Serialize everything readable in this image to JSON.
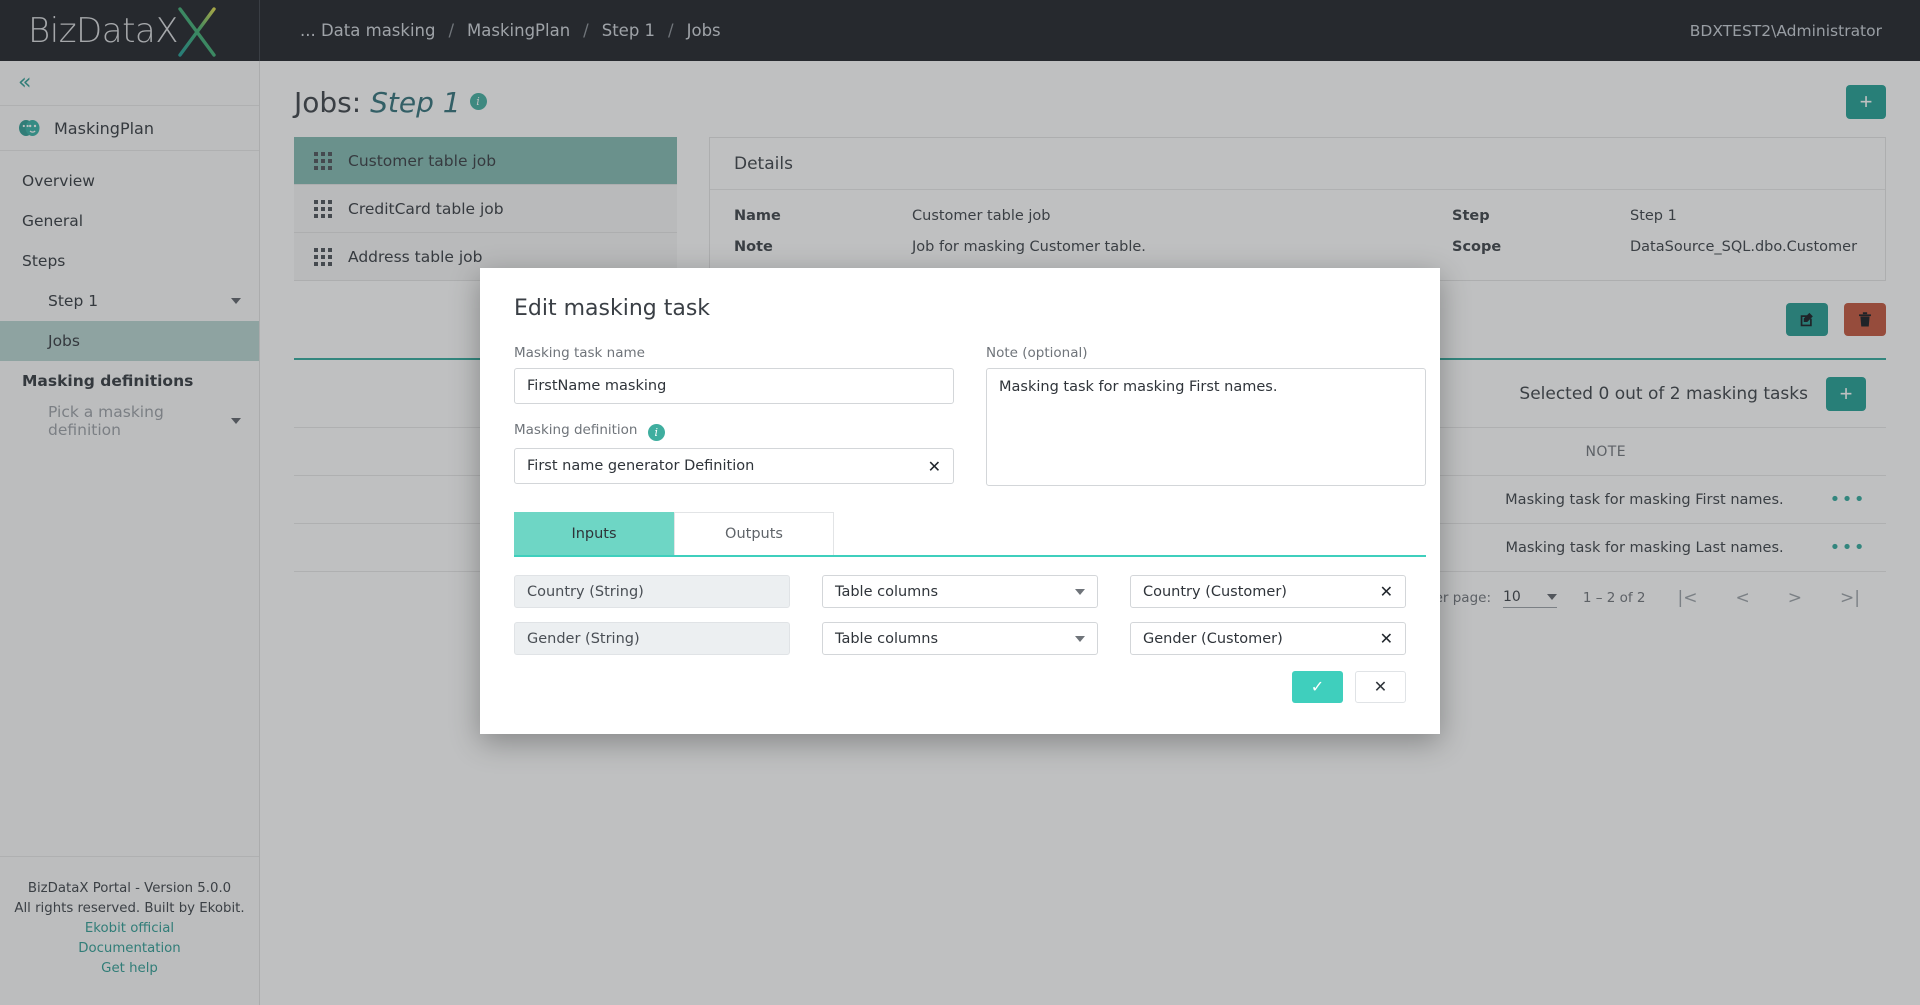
{
  "brand": {
    "name": "BizDataX",
    "logo_icon": "bizdatax-logo"
  },
  "topbar": {
    "breadcrumb": [
      {
        "label": "... Data masking"
      },
      {
        "label": "MaskingPlan"
      },
      {
        "label": "Step 1"
      },
      {
        "label": "Jobs"
      }
    ],
    "separator": "/",
    "user": "BDXTEST2\\Administrator"
  },
  "sidebar": {
    "collapse_icon": "double-chevron-left-icon",
    "plan": {
      "label": "MaskingPlan",
      "icon": "masks-icon"
    },
    "items": [
      {
        "label": "Overview"
      },
      {
        "label": "General"
      },
      {
        "label": "Steps"
      },
      {
        "label": "Step 1"
      },
      {
        "label": "Jobs"
      },
      {
        "label": "Masking definitions"
      },
      {
        "label": "Pick a masking definition"
      }
    ],
    "footer": {
      "version": "BizDataX Portal - Version 5.0.0",
      "rights": "All rights reserved. Built by Ekobit.",
      "links": [
        "Ekobit official",
        "Documentation",
        "Get help"
      ]
    }
  },
  "page": {
    "title_prefix": "Jobs: ",
    "title_em": "Step 1",
    "info_icon_glyph": "i",
    "add_button_label": "+"
  },
  "jobs": [
    {
      "label": "Customer table job"
    },
    {
      "label": "CreditCard table job"
    },
    {
      "label": "Address table job"
    }
  ],
  "details": {
    "heading": "Details",
    "rows": [
      {
        "k1": "Name",
        "v1": "Customer table job",
        "k2": "Step",
        "v2": "Step 1"
      },
      {
        "k1": "Note",
        "v1": "Job for masking Customer table.",
        "k2": "Scope",
        "v2": "DataSource_SQL.dbo.Customer"
      }
    ]
  },
  "actions": {
    "edit_icon": "edit-pencil-icon",
    "delete_icon": "trash-icon"
  },
  "tasks": {
    "selection_text": "Selected 0 out of 2 masking tasks",
    "add_label": "+",
    "column_header": "NOTE",
    "rows": [
      {
        "note": "Masking task for masking First names.",
        "menu": "•••"
      },
      {
        "note": "Masking task for masking Last names.",
        "menu": "•••"
      }
    ],
    "paginator": {
      "items_per_page_label": "Items per page:",
      "items_per_page_value": "10",
      "range": "1 – 2 of 2",
      "first": "|<",
      "prev": "<",
      "next": ">",
      "last": ">|"
    }
  },
  "modal": {
    "title": "Edit masking task",
    "name_label": "Masking task name",
    "name_value": "FirstName masking",
    "name_placeholder": "Masking task name",
    "definition_label": "Masking definition",
    "definition_value": "First name generator Definition",
    "definition_clear": "✕",
    "note_label": "Note (optional)",
    "note_value": "Masking task for masking First names.",
    "note_placeholder": "Note (optional)",
    "tabs": [
      {
        "label": "Inputs",
        "active": true
      },
      {
        "label": "Outputs",
        "active": false
      }
    ],
    "io_rows": [
      {
        "param": "Country (String)",
        "source": "Table columns",
        "mapped": "Country (Customer)",
        "clear": "✕"
      },
      {
        "param": "Gender (String)",
        "source": "Table columns",
        "mapped": "Gender (Customer)",
        "clear": "✕"
      }
    ],
    "confirm_label": "✓",
    "cancel_label": "✕"
  },
  "colors": {
    "accent_teal": "#2fa99b",
    "accent_light": "#3fcfbd",
    "selected_job": "#81bab1",
    "delete_red": "#c2533a",
    "topbar_dark": "#1b1e24"
  }
}
